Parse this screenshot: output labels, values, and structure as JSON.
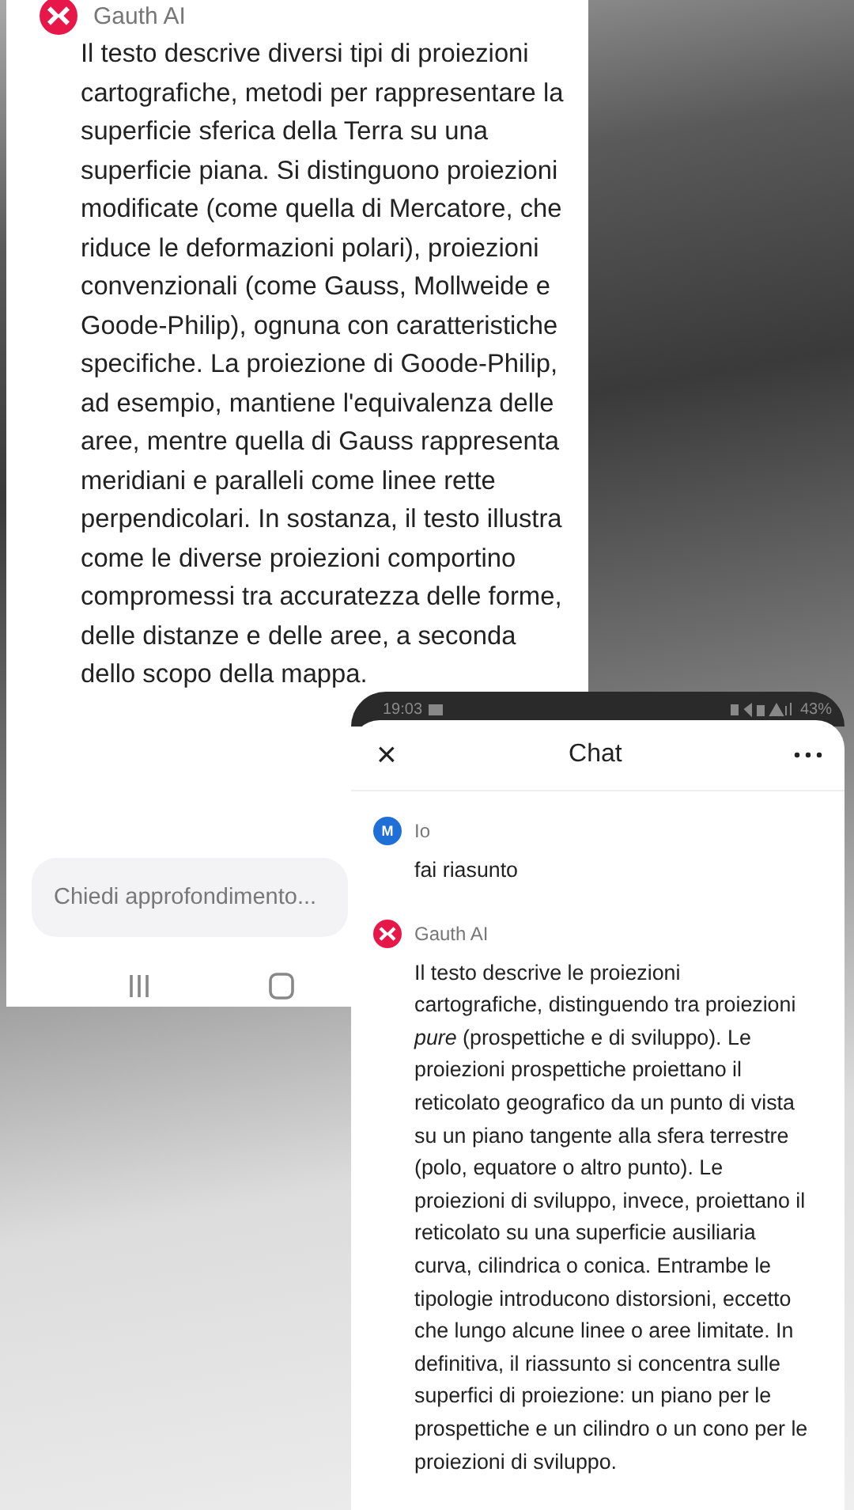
{
  "back_screen": {
    "sender": "Gauth AI",
    "message": "Il testo descrive diversi tipi di proiezioni cartografiche, metodi per rappresentare la superficie sferica della Terra su una superficie piana. Si distinguono proiezioni modificate (come quella di Mercatore, che riduce le deformazioni polari), proiezioni convenzionali (come Gauss, Mollweide e Goode-Philip), ognuna con caratteristiche specifiche. La proiezione di Goode-Philip, ad esempio, mantiene l'equivalenza delle aree, mentre quella di Gauss rappresenta meridiani e paralleli come linee rette perpendicolari. In sostanza, il testo illustra come le diverse proiezioni comportino compromessi tra accuratezza delle forme, delle distanze e delle aree, a seconda dello scopo della mappa.",
    "input": {
      "placeholder": "Chiedi approfondimento..."
    }
  },
  "front_screen": {
    "status_bar": {
      "time": "19:03",
      "battery": "43%"
    },
    "header": {
      "close": "×",
      "title": "Chat"
    },
    "messages": [
      {
        "kind": "user",
        "avatar": "M",
        "sender": "Io",
        "text": "fai riasunto"
      },
      {
        "kind": "bot",
        "sender": "Gauth AI",
        "text": "Il testo descrive le proiezioni cartografiche, distinguendo tra proiezioni *pure* (prospettiche e di sviluppo). Le proiezioni prospettiche proiettano il reticolato geografico da un punto di vista su un piano tangente alla sfera terrestre (polo, equatore o altro punto). Le proiezioni di sviluppo, invece, proiettano il reticolato su una superficie ausiliaria curva, cilindrica o conica. Entrambe le tipologie introducono distorsioni, eccetto che lungo alcune linee o aree limitate. In definitiva, il riassunto si concentra sulle superfici di proiezione: un piano per le prospettiche e un cilindro o un cono per le proiezioni di sviluppo."
      }
    ]
  }
}
